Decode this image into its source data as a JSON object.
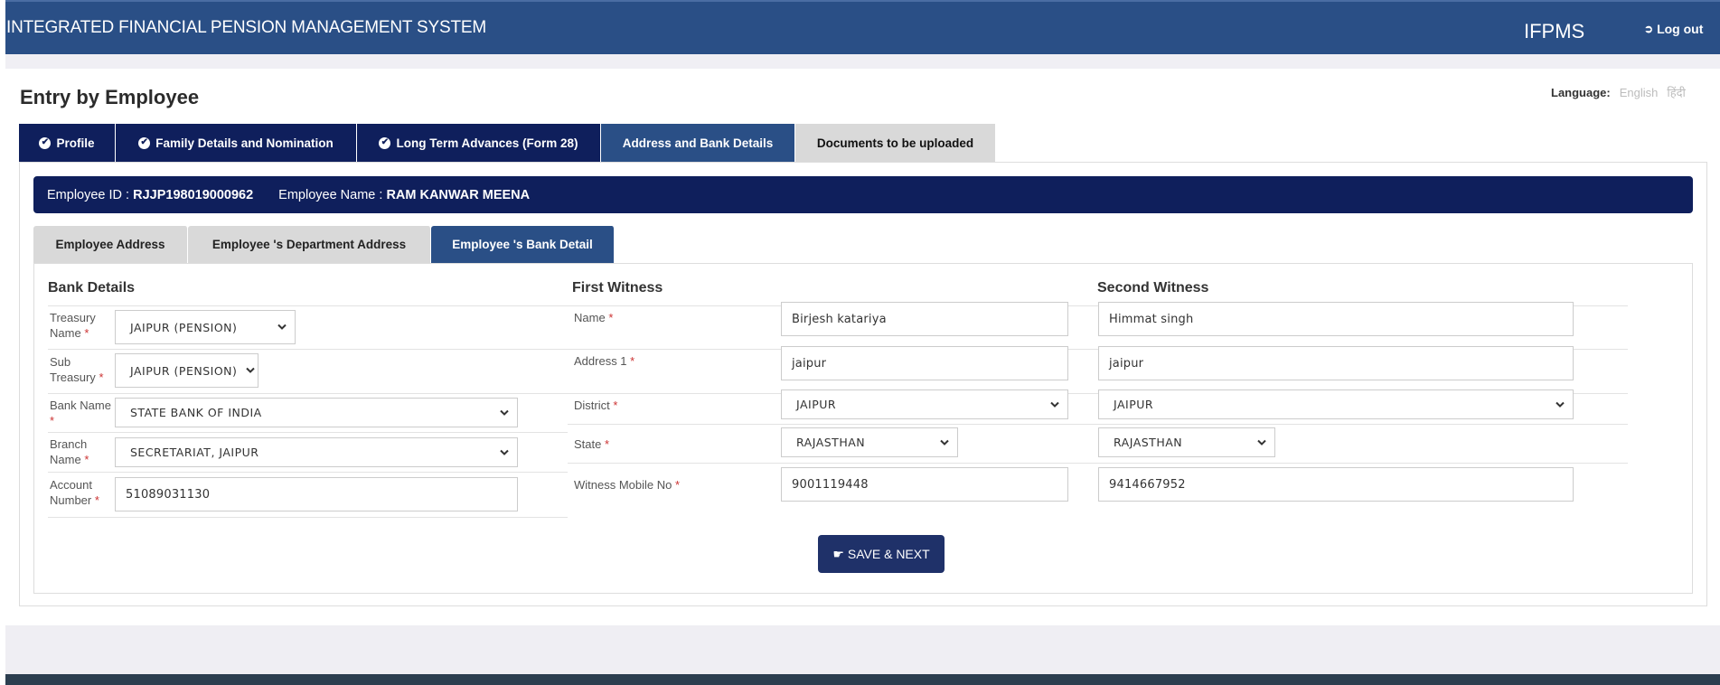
{
  "header": {
    "app_title": "INTEGRATED FINANCIAL PENSION MANAGEMENT SYSTEM",
    "app_abbr": "IFPMS",
    "logout_label": "Log out",
    "logout_icon": "sign-out-icon"
  },
  "page": {
    "title": "Entry by Employee",
    "language_label": "Language:",
    "languages": [
      "English",
      "हिंदी"
    ]
  },
  "main_tabs": [
    {
      "label": "Profile",
      "state": "done"
    },
    {
      "label": "Family Details and Nomination",
      "state": "done"
    },
    {
      "label": "Long Term Advances (Form 28)",
      "state": "done"
    },
    {
      "label": "Address and Bank Details",
      "state": "active"
    },
    {
      "label": "Documents to be uploaded",
      "state": "todo"
    }
  ],
  "employee": {
    "id_label": "Employee ID :",
    "id_value": "RJJP198019000962",
    "name_label": "Employee Name :",
    "name_value": "RAM KANWAR MEENA"
  },
  "sub_tabs": [
    {
      "label": "Employee Address",
      "active": false
    },
    {
      "label": "Employee 's Department Address",
      "active": false
    },
    {
      "label": "Employee 's Bank Detail",
      "active": true
    }
  ],
  "bank_details": {
    "title": "Bank Details",
    "fields": [
      {
        "label_line1": "Treasury",
        "label_line2": "Name",
        "value": "JAIPUR (PENSION)",
        "type": "select"
      },
      {
        "label_line1": "Sub",
        "label_line2": "Treasury",
        "value": "JAIPUR (PENSION)",
        "type": "select"
      },
      {
        "label_line1": "Bank Name",
        "label_line2": "",
        "value": "STATE BANK OF INDIA",
        "type": "select"
      },
      {
        "label_line1": "Branch",
        "label_line2": "Name",
        "value": "SECRETARIAT, JAIPUR",
        "type": "select"
      },
      {
        "label_line1": "Account",
        "label_line2": "Number",
        "value": "51089031130",
        "type": "text"
      }
    ]
  },
  "witness_labels": [
    "Name",
    "Address 1",
    "District",
    "State",
    "Witness Mobile No"
  ],
  "first_witness": {
    "title": "First Witness",
    "name": "Birjesh katariya",
    "address1": "jaipur",
    "district": "JAIPUR",
    "state": "RAJASTHAN",
    "mobile": "9001119448"
  },
  "second_witness": {
    "title": "Second Witness",
    "name": "Himmat singh",
    "address1": "jaipur",
    "district": "JAIPUR",
    "state": "RAJASTHAN",
    "mobile": "9414667952"
  },
  "actions": {
    "save_next_label": "SAVE & NEXT",
    "save_next_icon": "hand-point-right-icon"
  },
  "required_marker": "*",
  "colors": {
    "header_blue": "#2a4f86",
    "navy": "#0f1f5c",
    "button_navy": "#1f3169",
    "inactive_tab": "#d9d9d9",
    "required_red": "#cc3333"
  }
}
